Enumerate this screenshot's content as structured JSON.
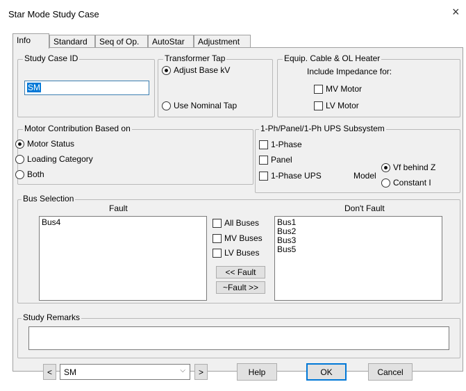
{
  "window": {
    "title": "Star Mode Study Case",
    "close_glyph": "×"
  },
  "tabs": [
    {
      "label": "Info"
    },
    {
      "label": "Standard"
    },
    {
      "label": "Seq of Op."
    },
    {
      "label": "AutoStar"
    },
    {
      "label": "Adjustment"
    }
  ],
  "study_case": {
    "legend": "Study Case ID",
    "value": "SM"
  },
  "transformer_tap": {
    "legend": "Transformer Tap",
    "adjust_label": "Adjust Base kV",
    "nominal_label": "Use Nominal Tap",
    "selected": "adjust"
  },
  "equip": {
    "legend": "Equip. Cable & OL Heater",
    "subtitle": "Include Impedance for:",
    "mv_label": "MV Motor",
    "lv_label": "LV Motor"
  },
  "motor_contribution": {
    "legend": "Motor Contribution Based on",
    "opt1": "Motor Status",
    "opt2": "Loading Category",
    "opt3": "Both",
    "selected": "Motor Status"
  },
  "subsystem": {
    "legend": "1-Ph/Panel/1-Ph UPS Subsystem",
    "phase_label": "1-Phase",
    "panel_label": "Panel",
    "ups_label": "1-Phase UPS",
    "model_label": "Model",
    "vf_label": "Vf behind Z",
    "ci_label": "Constant I",
    "selected": "Vf behind Z"
  },
  "bus_selection": {
    "legend": "Bus Selection",
    "fault_header": "Fault",
    "dont_fault_header": "Don't Fault",
    "fault_list": [
      "Bus4"
    ],
    "dont_fault_list": [
      "Bus1",
      "Bus2",
      "Bus3",
      "Bus5"
    ],
    "all_buses": "All Buses",
    "mv_buses": "MV Buses",
    "lv_buses": "LV Buses",
    "to_fault": "<< Fault",
    "to_dont_fault": "~Fault >>"
  },
  "remarks": {
    "legend": "Study Remarks",
    "value": ""
  },
  "footer": {
    "prev": "<",
    "next": ">",
    "combo_value": "SM",
    "combo_arrow": "⌵",
    "help": "Help",
    "ok": "OK",
    "cancel": "Cancel"
  }
}
